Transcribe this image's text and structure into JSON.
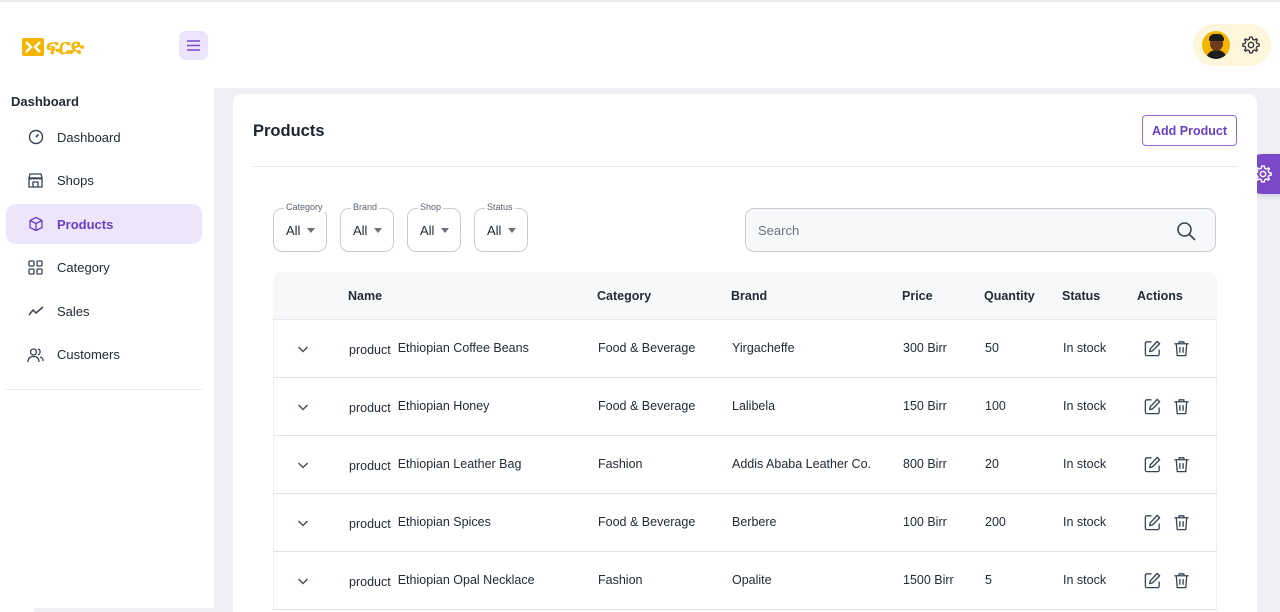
{
  "brand": {
    "logo_text": "ፍርድ"
  },
  "sidebar": {
    "section_title": "Dashboard",
    "items": [
      {
        "label": "Dashboard",
        "icon": "dashboard-icon"
      },
      {
        "label": "Shops",
        "icon": "store-icon"
      },
      {
        "label": "Products",
        "icon": "cube-icon",
        "active": true
      },
      {
        "label": "Category",
        "icon": "grid-icon"
      },
      {
        "label": "Sales",
        "icon": "trend-icon"
      },
      {
        "label": "Customers",
        "icon": "users-icon"
      }
    ]
  },
  "header": {
    "avatar": "user-avatar",
    "settings_icon": "gear-icon"
  },
  "main": {
    "title": "Products",
    "add_button": "Add Product",
    "filters": [
      {
        "label": "Category",
        "value": "All"
      },
      {
        "label": "Brand",
        "value": "All"
      },
      {
        "label": "Shop",
        "value": "All"
      },
      {
        "label": "Status",
        "value": "All"
      }
    ],
    "search": {
      "placeholder": "Search"
    },
    "table": {
      "columns": [
        "Name",
        "Category",
        "Brand",
        "Price",
        "Quantity",
        "Status",
        "Actions"
      ],
      "rows": [
        {
          "prefix": "product",
          "name": "Ethiopian Coffee Beans",
          "category": "Food & Beverage",
          "brand": "Yirgacheffe",
          "price": "300 Birr",
          "quantity": "50",
          "status": "In stock"
        },
        {
          "prefix": "product",
          "name": "Ethiopian Honey",
          "category": "Food & Beverage",
          "brand": "Lalibela",
          "price": "150 Birr",
          "quantity": "100",
          "status": "In stock"
        },
        {
          "prefix": "product",
          "name": "Ethiopian Leather Bag",
          "category": "Fashion",
          "brand": "Addis Ababa Leather Co.",
          "price": "800 Birr",
          "quantity": "20",
          "status": "In stock"
        },
        {
          "prefix": "product",
          "name": "Ethiopian Spices",
          "category": "Food & Beverage",
          "brand": "Berbere",
          "price": "100 Birr",
          "quantity": "200",
          "status": "In stock"
        },
        {
          "prefix": "product",
          "name": "Ethiopian Opal Necklace",
          "category": "Fashion",
          "brand": "Opalite",
          "price": "1500 Birr",
          "quantity": "5",
          "status": "In stock"
        }
      ]
    }
  },
  "colors": {
    "accent": "#7a48c9",
    "active_bg": "#ede5fa",
    "logo": "#f4b400"
  }
}
